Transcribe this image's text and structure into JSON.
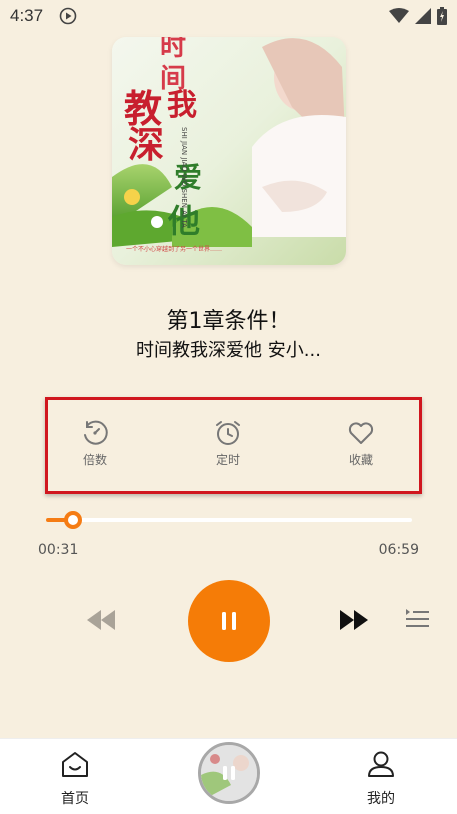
{
  "status": {
    "time": "4:37",
    "icons": [
      "play-circle-icon",
      "wifi-icon",
      "signal-icon",
      "battery-icon"
    ]
  },
  "cover": {
    "title_chars": [
      "时",
      "间",
      "教",
      "我",
      "深",
      "爱",
      "他"
    ],
    "romanized": "SHI JIAN JIAO WO SHEN AI TA",
    "blurb": "一个不小心穿越到了另一个世界……"
  },
  "track": {
    "title": "第1章条件！",
    "subtitle": "时间教我深爱他 安小..."
  },
  "controls": {
    "speed_label": "倍数",
    "timer_label": "定时",
    "favorite_label": "收藏"
  },
  "progress": {
    "current": "00:31",
    "total": "06:59",
    "fraction": 0.074
  },
  "colors": {
    "accent": "#f57c07",
    "background": "#f7efdf",
    "highlight_box": "#d0161e"
  },
  "nav": {
    "home_label": "首页",
    "mine_label": "我的"
  }
}
